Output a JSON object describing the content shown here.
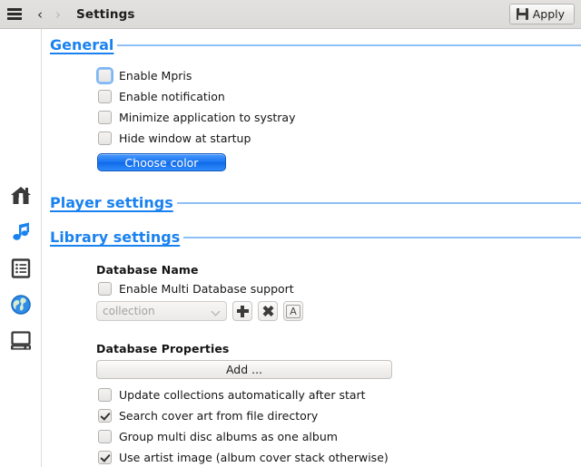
{
  "titlebar": {
    "menu_icon": "hamburger-icon",
    "back_label": "‹",
    "forward_label": "›",
    "title": "Settings",
    "apply_label": "Apply",
    "apply_icon": "save-floppy-icon"
  },
  "sidebar": {
    "items": [
      {
        "name": "home",
        "icon": "home-icon",
        "color": "#3a3a3a",
        "active": false
      },
      {
        "name": "music",
        "icon": "music-note-icon",
        "color": "#1a82f0",
        "active": true
      },
      {
        "name": "playlist",
        "icon": "list-icon",
        "color": "#3a3a3a",
        "active": false
      },
      {
        "name": "internet",
        "icon": "globe-icon",
        "color": "#1a82f0",
        "active": false
      },
      {
        "name": "device",
        "icon": "computer-icon",
        "color": "#3a3a3a",
        "active": false
      }
    ]
  },
  "colors": {
    "accent": "#1a82f0",
    "rule": "#8dc0f8",
    "titlebar_bg": "#dcdbd9",
    "text": "#151515"
  },
  "sections": {
    "general": {
      "title": "General",
      "checkboxes": [
        {
          "label": "Enable Mpris",
          "checked": false,
          "focused": true
        },
        {
          "label": "Enable notification",
          "checked": false,
          "focused": false
        },
        {
          "label": "Minimize application to systray",
          "checked": false,
          "focused": false
        },
        {
          "label": "Hide window at startup",
          "checked": false,
          "focused": false
        }
      ],
      "choose_color_label": "Choose color"
    },
    "player": {
      "title": "Player settings"
    },
    "library": {
      "title": "Library settings",
      "database_name_label": "Database Name",
      "multi_db_checkbox": {
        "label": "Enable Multi Database support",
        "checked": false
      },
      "db_combo_value": "collection",
      "db_add_button": "+",
      "db_remove_button": "✖",
      "db_rename_button": "A",
      "database_properties_label": "Database Properties",
      "add_button_label": "Add ...",
      "checkboxes": [
        {
          "label": "Update collections automatically after start",
          "checked": false
        },
        {
          "label": "Search cover art from file directory",
          "checked": true
        },
        {
          "label": "Group multi disc albums as one album",
          "checked": false
        },
        {
          "label": "Use artist image (album cover stack otherwise)",
          "checked": true
        }
      ]
    }
  }
}
